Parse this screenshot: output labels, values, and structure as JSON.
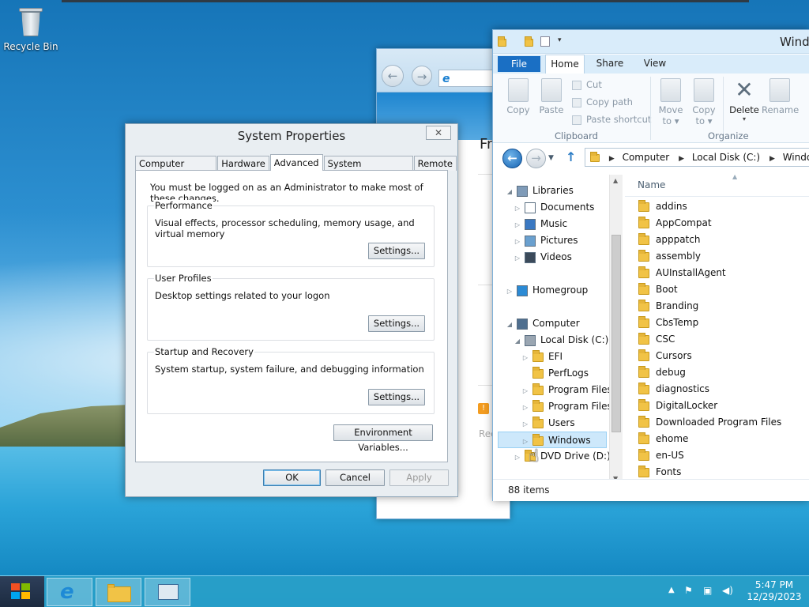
{
  "desktop": {
    "recycle_bin_label": "Recycle Bin"
  },
  "ie_window": {
    "heading_partial": "Fr",
    "footer_partial": "Rec"
  },
  "system_properties": {
    "title": "System Properties",
    "close_glyph": "✕",
    "tabs": [
      {
        "label": "Computer Name",
        "active": false
      },
      {
        "label": "Hardware",
        "active": false
      },
      {
        "label": "Advanced",
        "active": true
      },
      {
        "label": "System Protection",
        "active": false
      },
      {
        "label": "Remote",
        "active": false
      }
    ],
    "admin_note": "You must be logged on as an Administrator to make most of these changes.",
    "groups": [
      {
        "label": "Performance",
        "description": "Visual effects, processor scheduling, memory usage, and virtual memory",
        "button": "Settings..."
      },
      {
        "label": "User Profiles",
        "description": "Desktop settings related to your logon",
        "button": "Settings..."
      },
      {
        "label": "Startup and Recovery",
        "description": "System startup, system failure, and debugging information",
        "button": "Settings..."
      }
    ],
    "env_button": "Environment Variables...",
    "ok": "OK",
    "cancel": "Cancel",
    "apply": "Apply"
  },
  "explorer": {
    "title_partial": "Windo",
    "ribbon_tabs": {
      "file": "File",
      "home": "Home",
      "share": "Share",
      "view": "View"
    },
    "ribbon": {
      "copy": "Copy",
      "paste": "Paste",
      "cut": "Cut",
      "copy_path": "Copy path",
      "paste_shortcut": "Paste shortcut",
      "move_to": "Move to ▾",
      "copy_to": "Copy to ▾",
      "delete": "Delete",
      "delete_arrow": "▾",
      "rename": "Rename",
      "clipboard_group": "Clipboard",
      "organize_group": "Organize"
    },
    "breadcrumb": [
      "Computer",
      "Local Disk (C:)",
      "Windows"
    ],
    "tree": [
      {
        "label": "Libraries",
        "arrow": "◢",
        "level": 0
      },
      {
        "label": "Documents",
        "arrow": "▷",
        "level": 1
      },
      {
        "label": "Music",
        "arrow": "▷",
        "level": 1
      },
      {
        "label": "Pictures",
        "arrow": "▷",
        "level": 1
      },
      {
        "label": "Videos",
        "arrow": "▷",
        "level": 1
      },
      {
        "label": "Homegroup",
        "arrow": "▷",
        "level": 0
      },
      {
        "label": "Computer",
        "arrow": "◢",
        "level": 0
      },
      {
        "label": "Local Disk (C:)",
        "arrow": "◢",
        "level": 1
      },
      {
        "label": "EFI",
        "arrow": "▷",
        "level": 2
      },
      {
        "label": "PerfLogs",
        "arrow": "",
        "level": 2
      },
      {
        "label": "Program Files",
        "arrow": "▷",
        "level": 2
      },
      {
        "label": "Program Files (",
        "arrow": "▷",
        "level": 2
      },
      {
        "label": "Users",
        "arrow": "▷",
        "level": 2
      },
      {
        "label": "Windows",
        "arrow": "▷",
        "level": 2,
        "selected": true
      },
      {
        "label": "DVD Drive (D:) HI",
        "arrow": "▷",
        "level": 1
      }
    ],
    "column_name": "Name",
    "files": [
      "addins",
      "AppCompat",
      "apppatch",
      "assembly",
      "AUInstallAgent",
      "Boot",
      "Branding",
      "CbsTemp",
      "CSC",
      "Cursors",
      "debug",
      "diagnostics",
      "DigitalLocker",
      "Downloaded Program Files",
      "ehome",
      "en-US",
      "Fonts"
    ],
    "status": "88 items"
  },
  "taskbar": {
    "time": "5:47 PM",
    "date": "12/29/2023"
  },
  "colors": {
    "accent": "#1a6fc4",
    "selection": "#cde8fb",
    "folder": "#f1c346"
  }
}
